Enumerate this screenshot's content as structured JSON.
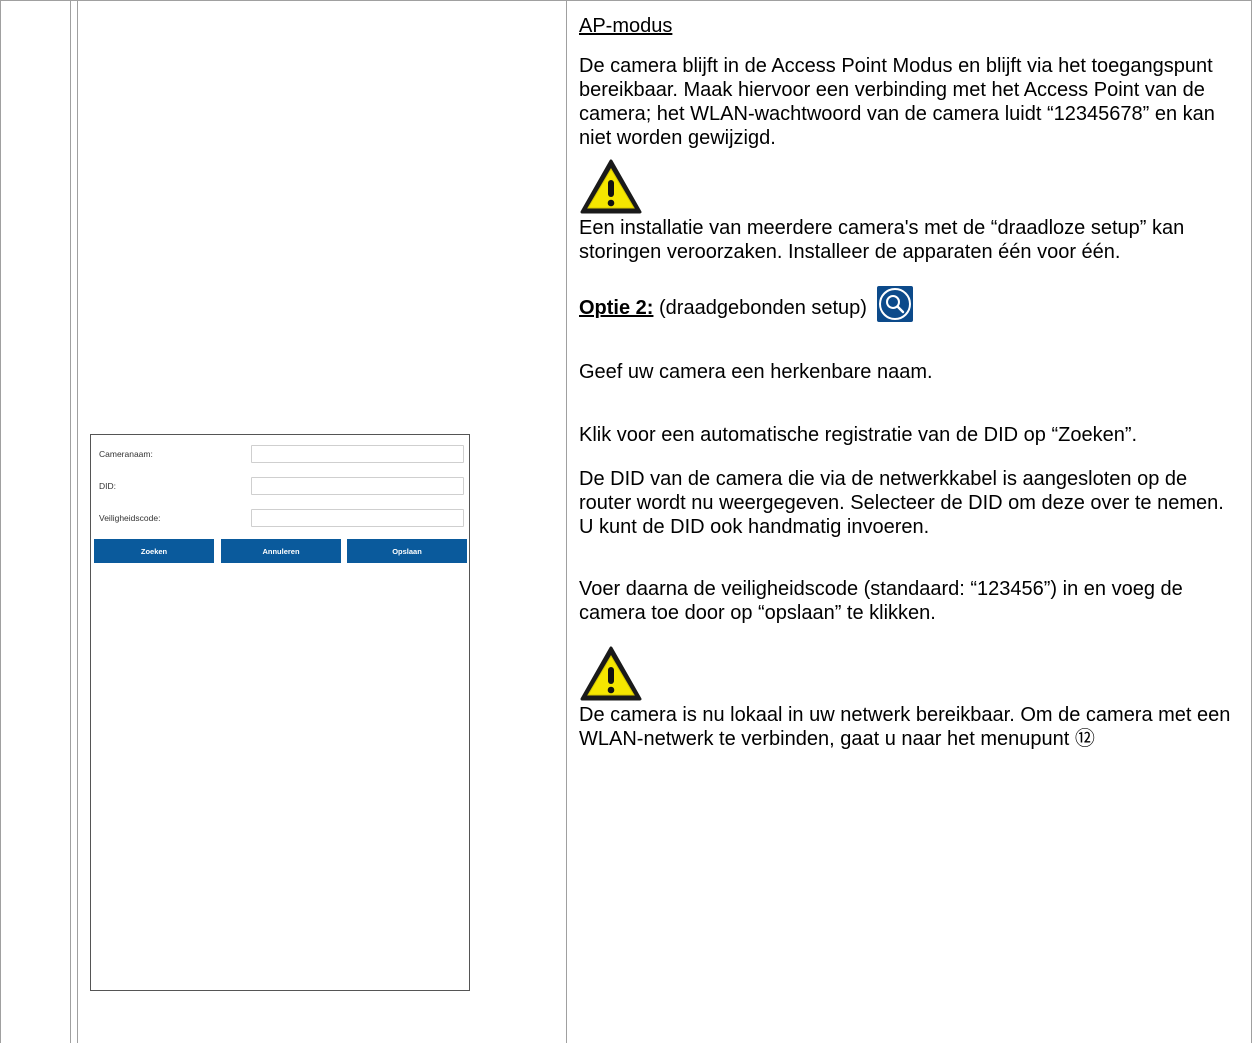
{
  "left_mock": {
    "fields": [
      {
        "label": "Cameranaam:",
        "value": ""
      },
      {
        "label": "DID:",
        "value": ""
      },
      {
        "label": "Veiligheidscode:",
        "value": ""
      }
    ],
    "buttons": [
      "Zoeken",
      "Annuleren",
      "Opslaan"
    ],
    "button_color": "#0a5a9c"
  },
  "text": {
    "heading_ap": "AP-modus",
    "p_ap": "De camera blijft in de Access Point Modus en blijft via het toegangspunt bereikbaar. Maak hiervoor een verbinding met het Access Point van de camera; het WLAN-wachtwoord van de camera luidt “12345678” en kan niet worden gewijzigd.",
    "warning_1": "Een installatie van meerdere camera's met de “draadloze setup” kan storingen veroorzaken. Installeer de apparaten één voor één.",
    "option2_label": "Optie 2:",
    "option2_text": "(draadgebonden setup)",
    "p_name": "Geef uw camera een herkenbare naam.",
    "p_search": "Klik voor een automatische registratie van de DID op “Zoeken”.",
    "p_did": "De DID van de camera die via de netwerkkabel is aangesloten op de router wordt nu weergegeven. Selecteer de DID om deze over te nemen. U kunt de DID ook handmatig invoeren.",
    "p_code": "Voer daarna de veiligheidscode (standaard: “123456”) in en voeg de camera toe door op “opslaan” te klikken.",
    "warning_2": "De camera is nu lokaal in uw netwerk bereikbaar. Om de camera met een WLAN-netwerk te verbinden, gaat u naar het menupunt ⑫"
  },
  "icons": {
    "warning": "warning-triangle-icon",
    "search": "magnifier-icon"
  }
}
